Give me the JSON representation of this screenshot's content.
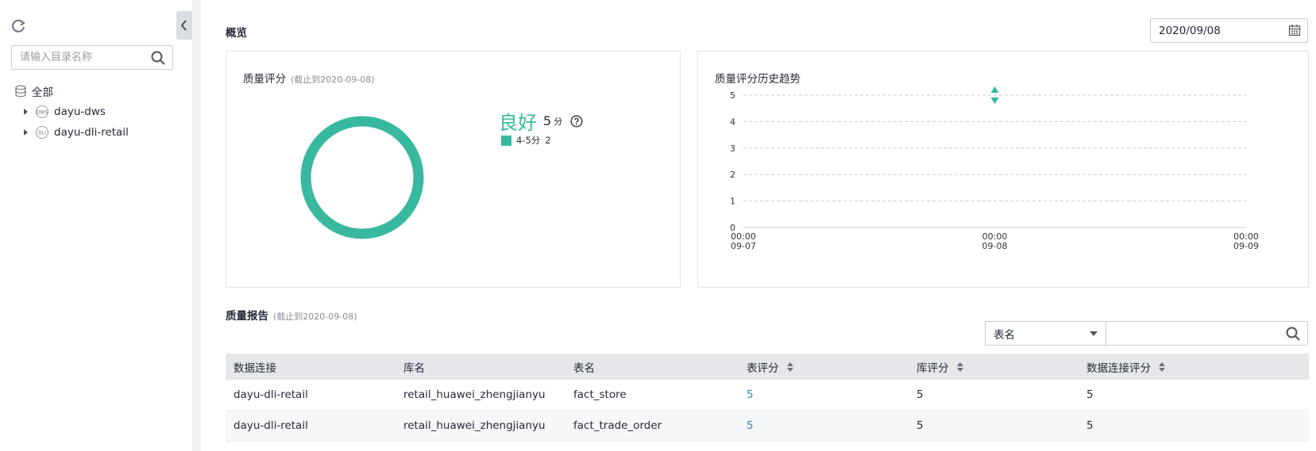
{
  "sidebar": {
    "search_placeholder": "请输入目录名称",
    "tree": {
      "root_label": "全部",
      "children": [
        {
          "label": "dayu-dws",
          "badge": "DWS"
        },
        {
          "label": "dayu-dli-retail",
          "badge": "DLI"
        }
      ]
    }
  },
  "header": {
    "title": "概览",
    "date": "2020/09/08"
  },
  "score_card": {
    "title": "质量评分",
    "subtitle": "(截止到2020-09-08)",
    "grade": "良好",
    "score": "5",
    "unit": "分",
    "legend": [
      {
        "label": "4-5分",
        "count": "2",
        "color": "#38b99f"
      }
    ]
  },
  "trend_card": {
    "title": "质量评分历史趋势"
  },
  "chart_data": {
    "type": "line",
    "title": "质量评分历史趋势",
    "y_ticks": [
      "0",
      "1",
      "2",
      "3",
      "4",
      "5"
    ],
    "ylim": [
      0,
      5
    ],
    "x_ticks": [
      {
        "time": "00:00",
        "date": "09-07"
      },
      {
        "time": "00:00",
        "date": "09-08"
      },
      {
        "time": "00:00",
        "date": "09-09"
      }
    ],
    "series": [
      {
        "x": [
          "09-08 00:00"
        ],
        "values": [
          5
        ]
      }
    ],
    "grid": true,
    "colors": {
      "line": "#38b99f",
      "grid": "#c8cbd1"
    }
  },
  "report": {
    "title": "质量报告",
    "subtitle": "(截止到2020-09-08)",
    "filter_select": "表名",
    "filter_placeholder": "",
    "columns": [
      "数据连接",
      "库名",
      "表名",
      "表评分",
      "库评分",
      "数据连接评分"
    ],
    "rows": [
      [
        "dayu-dli-retail",
        "retail_huawei_zhengjianyu",
        "fact_store",
        "5",
        "5",
        "5"
      ],
      [
        "dayu-dli-retail",
        "retail_huawei_zhengjianyu",
        "fact_trade_order",
        "5",
        "5",
        "5"
      ]
    ]
  },
  "icons": {
    "refresh": "refresh-icon",
    "search": "search-icon",
    "collapse": "chevron-left-icon",
    "calendar": "calendar-icon",
    "help": "question-circle-icon",
    "database": "database-icon"
  },
  "colors": {
    "accent": "#38b99f",
    "link": "#3b82c4"
  }
}
